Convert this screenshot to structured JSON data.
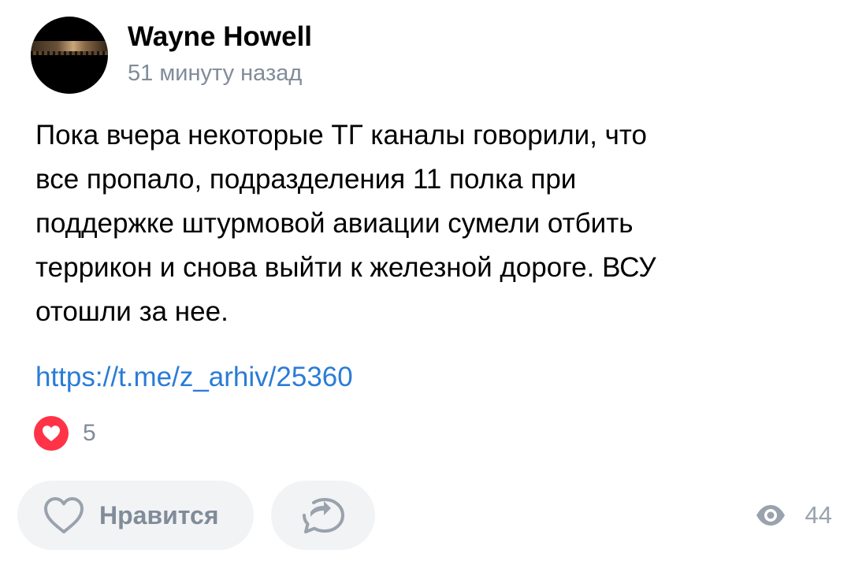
{
  "post": {
    "author": {
      "name": "Wayne Howell",
      "avatar_icon": "avatar-image"
    },
    "time": "51 минуту назад",
    "text": "Пока вчера некоторые ТГ каналы говорили, что\nвсе пропало, подразделения 11 полка при\nподдержке штурмовой авиации сумели отбить\nтеррикон и снова выйти к железной дороге. ВСУ\nотошли за нее.",
    "link": "https://t.me/z_arhiv/25360",
    "reactions": {
      "icon": "heart-icon",
      "count": "5"
    },
    "actions": {
      "like_label": "Нравится",
      "like_icon": "heart-outline-icon",
      "share_icon": "share-icon"
    },
    "views": {
      "icon": "eye-icon",
      "count": "44"
    }
  },
  "colors": {
    "text_primary": "#000000",
    "text_secondary": "#818c99",
    "link": "#2a7cd6",
    "reaction_heart": "#ff3347",
    "button_bg": "#f2f3f5",
    "icon_gray": "#99a2ad"
  }
}
